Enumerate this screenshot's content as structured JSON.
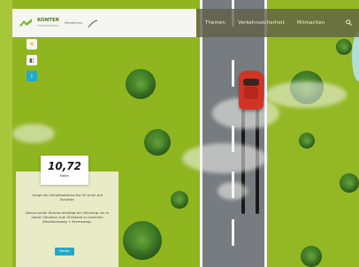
{
  "header": {
    "logo_name": "KONTER",
    "logo_tagline": "STAEDTEWERK",
    "partner_label": "Ministerium",
    "nav": [
      {
        "label": "Themen"
      },
      {
        "label": "Verkehrssicherheit"
      },
      {
        "label": "Mitmachen"
      }
    ]
  },
  "tools": [
    "sun-icon",
    "toggle-icon",
    "info-icon"
  ],
  "distance": {
    "value": "10,72",
    "unit": "Meter"
  },
  "panel": {
    "question": "Länge der Anhaltestrecke bei 30 km/h auf Schotter",
    "explanation": "Genau soviel Strecke benötigt ein Fahrzeug um in dieser Situation zum Stillstand zu kommen (Reaktionsweg + Bremsweg).",
    "button_label": "Weiter"
  },
  "colors": {
    "grass": "#8fb51f",
    "road": "#777c80",
    "car": "#d23323",
    "accent": "#22a9c9"
  }
}
